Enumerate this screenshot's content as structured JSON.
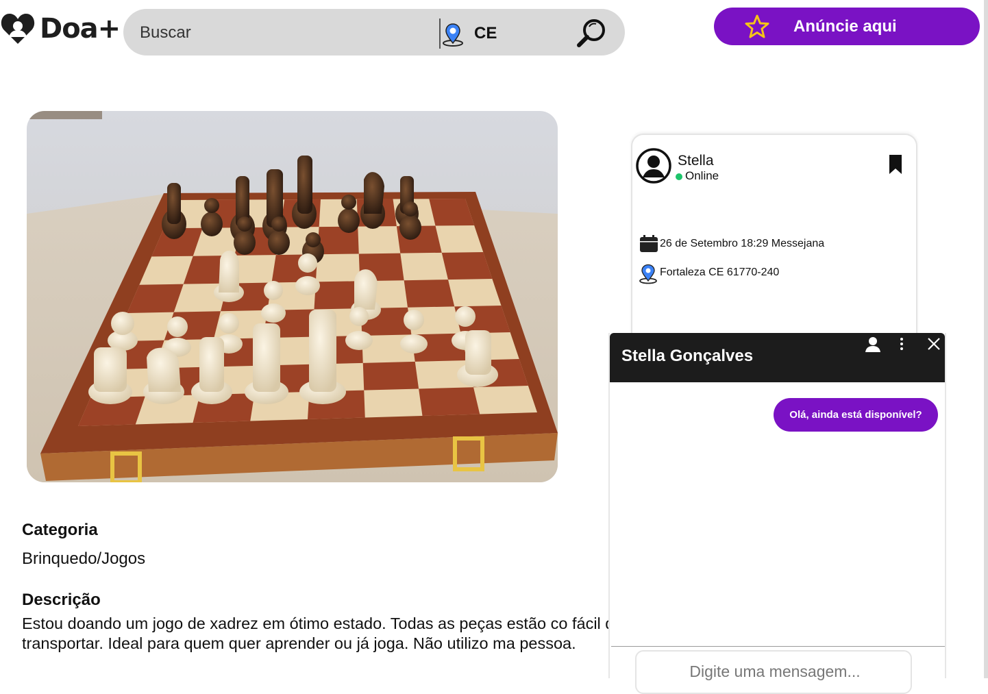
{
  "header": {
    "logo_text": "Doa+",
    "search_placeholder": "Buscar",
    "location": "CE",
    "ad_button_label": "Anúncie aqui"
  },
  "listing": {
    "image_description": "chess-board-photo",
    "category_heading": "Categoria",
    "category_value": "Brinquedo/Jogos",
    "description_heading": "Descrição",
    "description_text": "Estou doando um jogo de xadrez em ótimo estado. Todas as peças estão co fácil de transportar. Ideal para quem quer aprender ou já joga. Não utilizo ma pessoa."
  },
  "seller": {
    "name": "Stella",
    "status": "Online",
    "date_info": "26 de Setembro 18:29 Messejana",
    "address": "Fortaleza CE 61770-240"
  },
  "chat": {
    "title": "Stella Gonçalves",
    "messages": [
      {
        "from": "me",
        "text": "Olá, ainda está disponível?"
      }
    ],
    "input_placeholder": "Digite uma mensagem..."
  },
  "colors": {
    "brand_purple": "#7a12c4",
    "star_yellow": "#f5c518",
    "online_green": "#1dc46b",
    "chat_header": "#1c1c1c",
    "search_bg": "#d9d9d9"
  }
}
